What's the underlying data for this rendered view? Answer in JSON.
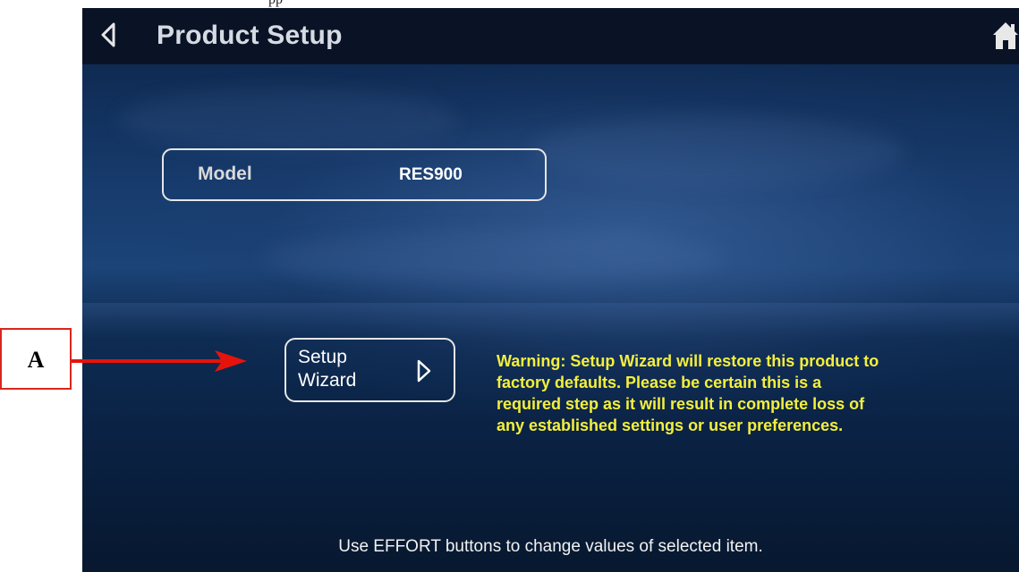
{
  "document": {
    "text_fragment": "pp"
  },
  "screen": {
    "title": "Product Setup",
    "back_icon": "back-chevron-icon",
    "home_icon": "home-icon",
    "model": {
      "label": "Model",
      "value": "RES900"
    },
    "setup_wizard": {
      "line1": "Setup",
      "line2": "Wizard",
      "icon": "chevron-right-icon"
    },
    "warning_text": "Warning: Setup Wizard will restore this product to factory defaults. Please be certain this is a required step as it will result in complete loss of any established settings or user preferences.",
    "footer_text": "Use EFFORT buttons to change values of selected item.",
    "colors": {
      "title_bar": "#0a1326",
      "warning": "#f4ef3c",
      "callout": "#d9261c"
    }
  },
  "callout": {
    "label": "A"
  }
}
